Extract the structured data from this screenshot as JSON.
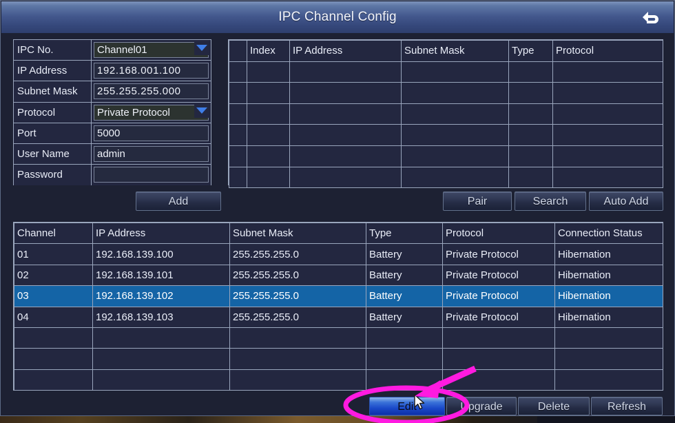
{
  "window": {
    "title": "IPC Channel Config",
    "back_icon": "return-arrow-icon"
  },
  "form": {
    "rows": [
      {
        "label": "IPC No.",
        "value": "Channel01",
        "type": "select"
      },
      {
        "label": "IP Address",
        "value": "192.168.001.100",
        "type": "ip"
      },
      {
        "label": "Subnet Mask",
        "value": "255.255.255.000",
        "type": "ip"
      },
      {
        "label": "Protocol",
        "value": "Private Protocol",
        "type": "select"
      },
      {
        "label": "Port",
        "value": "5000",
        "type": "text"
      },
      {
        "label": "User Name",
        "value": "admin",
        "type": "text"
      },
      {
        "label": "Password",
        "value": "",
        "type": "password"
      }
    ],
    "add_label": "Add"
  },
  "search_table": {
    "columns": [
      "",
      "Index",
      "IP Address",
      "Subnet Mask",
      "Type",
      "Protocol"
    ],
    "rows": [],
    "empty_row_count": 6
  },
  "search_actions": {
    "pair_label": "Pair",
    "search_label": "Search",
    "auto_add_label": "Auto Add"
  },
  "channel_table": {
    "columns": [
      "Channel",
      "IP Address",
      "Subnet Mask",
      "Type",
      "Protocol",
      "Connection Status"
    ],
    "rows": [
      {
        "channel": "01",
        "ip": "192.168.139.100",
        "mask": "255.255.255.0",
        "type": "Battery",
        "protocol": "Private Protocol",
        "status": "Hibernation",
        "selected": false
      },
      {
        "channel": "02",
        "ip": "192.168.139.101",
        "mask": "255.255.255.0",
        "type": "Battery",
        "protocol": "Private Protocol",
        "status": "Hibernation",
        "selected": false
      },
      {
        "channel": "03",
        "ip": "192.168.139.102",
        "mask": "255.255.255.0",
        "type": "Battery",
        "protocol": "Private Protocol",
        "status": "Hibernation",
        "selected": true
      },
      {
        "channel": "04",
        "ip": "192.168.139.103",
        "mask": "255.255.255.0",
        "type": "Battery",
        "protocol": "Private Protocol",
        "status": "Hibernation",
        "selected": false
      }
    ],
    "empty_row_count": 3
  },
  "bottom_actions": {
    "edit_label": "Edit",
    "upgrade_label": "Upgrade",
    "delete_label": "Delete",
    "refresh_label": "Refresh",
    "active": "Edit"
  },
  "annotation": {
    "highlight_color": "#ff1ae0",
    "highlight_target": "Edit",
    "shapes": [
      "ellipse",
      "arrow"
    ]
  },
  "colors": {
    "title_bar": "#42578c",
    "window_bg": "#1d2133",
    "grid_line": "#9aa6bd",
    "row_selected": "#1464a6",
    "accent_blue": "#3f7ee8"
  }
}
